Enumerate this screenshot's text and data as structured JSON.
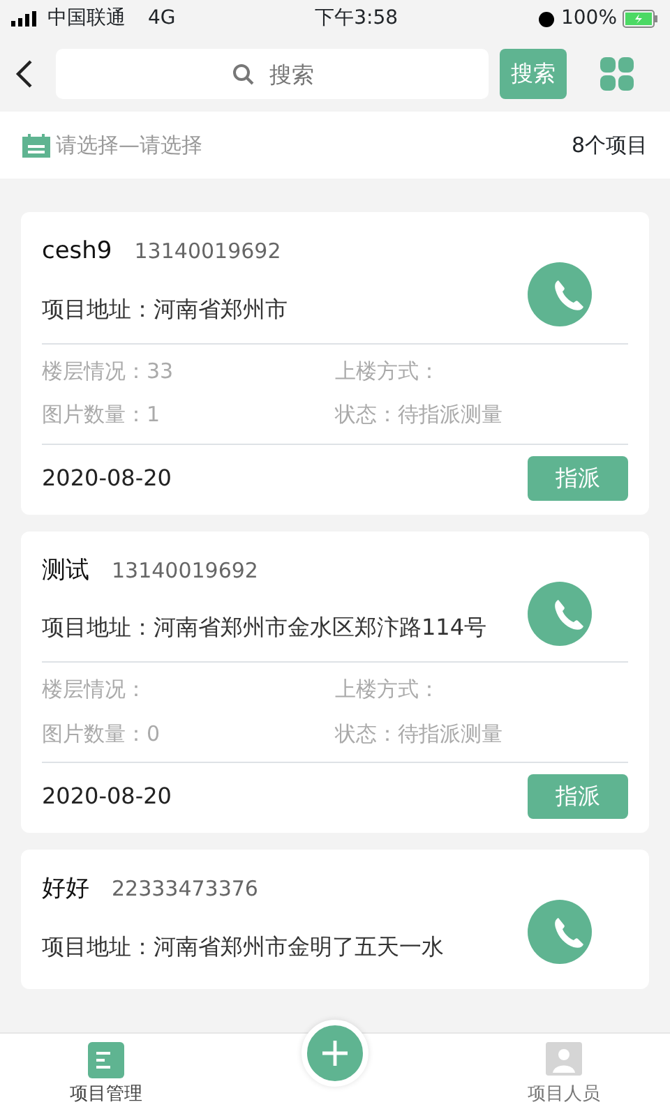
{
  "status_bar": {
    "carrier": "中国联通",
    "network": "4G",
    "time": "下午3:58",
    "battery": "100%"
  },
  "header": {
    "search_placeholder": "搜索",
    "search_button": "搜索"
  },
  "filter": {
    "label": "请选择—请选择",
    "count": "8个项目"
  },
  "projects": [
    {
      "name": "cesh9",
      "phone": "13140019692",
      "address": "项目地址：河南省郑州市",
      "floors": "楼层情况：33",
      "stairs": "上楼方式：",
      "photos": "图片数量：1",
      "status": "状态：待指派测量",
      "date": "2020-08-20",
      "action": "指派"
    },
    {
      "name": "测试",
      "phone": "13140019692",
      "address": "项目地址：河南省郑州市金水区郑汴路114号",
      "floors": "楼层情况：",
      "stairs": "上楼方式：",
      "photos": "图片数量：0",
      "status": "状态：待指派测量",
      "date": "2020-08-20",
      "action": "指派"
    },
    {
      "name": "好好",
      "phone": "22333473376",
      "address": "项目地址：河南省郑州市金明了五天一水"
    }
  ],
  "tabs": [
    {
      "label": "项目管理",
      "kind": "list",
      "selected": true
    },
    {
      "label": "项目人员",
      "kind": "person",
      "selected": false
    }
  ]
}
